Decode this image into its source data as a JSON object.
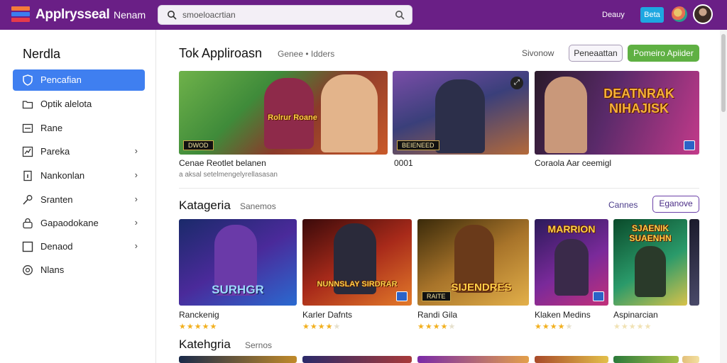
{
  "topbar": {
    "brand": "Applrysseal",
    "nav_link": "Nenam",
    "search_placeholder": "smoeloacrtian",
    "right_link": "Deauy",
    "button_label": "Beta",
    "colors": {
      "bar": "#6a1f86",
      "button": "#1ea7e1"
    }
  },
  "sidebar": {
    "title": "Nerdla",
    "items": [
      {
        "label": "Pencafian",
        "icon": "shield-icon",
        "active": true,
        "arrow": ""
      },
      {
        "label": "Optik alelota",
        "icon": "folder-icon",
        "active": false,
        "arrow": ""
      },
      {
        "label": "Rane",
        "icon": "window-icon",
        "active": false,
        "arrow": ""
      },
      {
        "label": "Pareka",
        "icon": "chart-icon",
        "active": false,
        "arrow": "›"
      },
      {
        "label": "Nankonlan",
        "icon": "info-icon",
        "active": false,
        "arrow": "›"
      },
      {
        "label": "Sranten",
        "icon": "wrench-icon",
        "active": false,
        "arrow": "›"
      },
      {
        "label": "Gapaodokane",
        "icon": "lock-icon",
        "active": false,
        "arrow": "›"
      },
      {
        "label": "Denaod",
        "icon": "square-icon",
        "active": false,
        "arrow": "›"
      },
      {
        "label": "Nlans",
        "icon": "badge-icon",
        "active": false,
        "arrow": ""
      }
    ]
  },
  "featured": {
    "title": "Tok Appliroasn",
    "subtitle": "Genee • Idders",
    "link": "Sivonow",
    "outline_button": "Peneaattan",
    "green_button": "Pomeiro Apiider",
    "cards": [
      {
        "badge": "DWOD",
        "art_text": "Rolrur Roane",
        "caption": "Cenae Reotlet belanen",
        "sub": "a aksal setelmengelyrellasasan"
      },
      {
        "badge": "BEIENEED",
        "art_text": "",
        "caption": "0001",
        "sub": ""
      },
      {
        "badge": "",
        "art_text": "DEATNRAK NIHAJISK",
        "caption": "Coraola Aar ceemigl",
        "sub": ""
      }
    ]
  },
  "categories": {
    "title": "Katageria",
    "subtitle": "Sanemos",
    "link": "Cannes",
    "button": "Eganove",
    "games": [
      {
        "name": "Ranckenig",
        "art_text": "SURHGR",
        "badge": "",
        "rating": 5
      },
      {
        "name": "Karler Dafnts",
        "art_text": "NUNNSLAY SIRDRAR",
        "badge": "",
        "rating": 4
      },
      {
        "name": "Randi Gila",
        "art_text": "SIJENDRES",
        "badge": "RAITE",
        "rating": 4
      },
      {
        "name": "Klaken Medins",
        "art_text": "MARRION",
        "badge": "",
        "rating": 4
      },
      {
        "name": "Aspinarcian",
        "art_text": "SJAENIK SUAENHN",
        "badge": "",
        "rating": 0
      }
    ]
  },
  "categories2": {
    "title": "Katehgria",
    "subtitle": "Sernos"
  }
}
